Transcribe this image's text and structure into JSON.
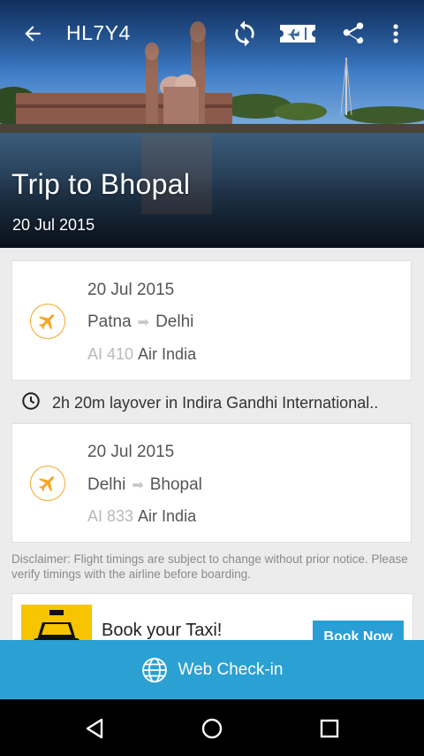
{
  "toolbar": {
    "pnr": "HL7Y4",
    "icons": [
      "back-arrow-icon",
      "refresh-icon",
      "boarding-pass-icon",
      "share-icon",
      "overflow-menu-icon"
    ]
  },
  "hero": {
    "title": "Trip to  Bhopal",
    "date": "20 Jul 2015"
  },
  "flights": [
    {
      "date": "20 Jul 2015",
      "from": "Patna",
      "to": "Delhi",
      "code": "AI 410",
      "airline": "Air India"
    },
    {
      "date": "20 Jul 2015",
      "from": "Delhi",
      "to": "Bhopal",
      "code": "AI 833",
      "airline": "Air India"
    }
  ],
  "layover": {
    "text": "2h 20m  layover in  Indira Gandhi International.."
  },
  "disclaimer": "Disclaimer: Flight timings are subject to change without prior notice. Please verify timings with the airline before boarding.",
  "promo": {
    "text": "Book your Taxi!",
    "button": "Book Now"
  },
  "checkin": {
    "label": "Web Check-in"
  },
  "colors": {
    "accent": "#2aa0d3",
    "plane": "#f5a623"
  }
}
